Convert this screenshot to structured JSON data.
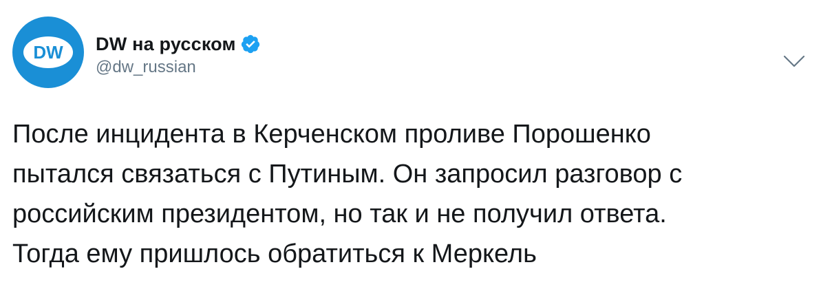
{
  "account": {
    "display_name": "DW на русском",
    "handle": "@dw_russian",
    "verified": true,
    "avatar_icon": "dw-logo-icon",
    "avatar_color": "#1a8fd6"
  },
  "menu": {
    "icon": "chevron-down-icon"
  },
  "tweet": {
    "lines": [
      "После инцидента в Керченском проливе Порошенко",
      "пытался связаться с Путиным. Он запросил разговор с",
      "российским президентом, но так и не получил ответа.",
      "Тогда ему пришлось обратиться к Меркель"
    ]
  },
  "colors": {
    "text": "#14171a",
    "secondary": "#657786",
    "verified_badge": "#1da1f2"
  }
}
